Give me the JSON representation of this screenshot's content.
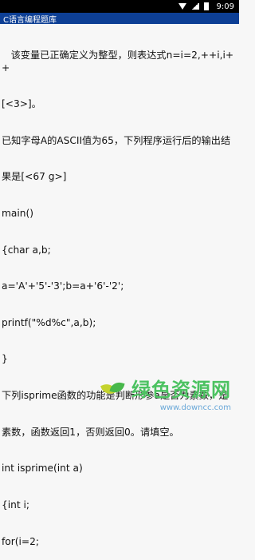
{
  "status": {
    "time": "9:09"
  },
  "app": {
    "title": "C语言编程题库"
  },
  "content": {
    "lines": [
      "   该变量已正确定义为整型，则表达式n=i=2,++i,i++",
      "[<3>]。",
      "已知字母A的ASCII值为65，下列程序运行后的输出结",
      "果是[<67 g>]",
      "main()",
      "{char a,b;",
      "a='A'+'5'-'3';b=a+'6'-'2';",
      "printf(\"%d%c\",a,b);",
      "}",
      "下列isprime函数的功能是判断形参a是否为素数，是",
      "素数，函数返回1，否则返回0。请填空。",
      "int isprime(int a)",
      "{int i;",
      "for(i=2;"
    ]
  },
  "watermark": {
    "text": "绿色资源网",
    "url": "www.downcc.com"
  }
}
